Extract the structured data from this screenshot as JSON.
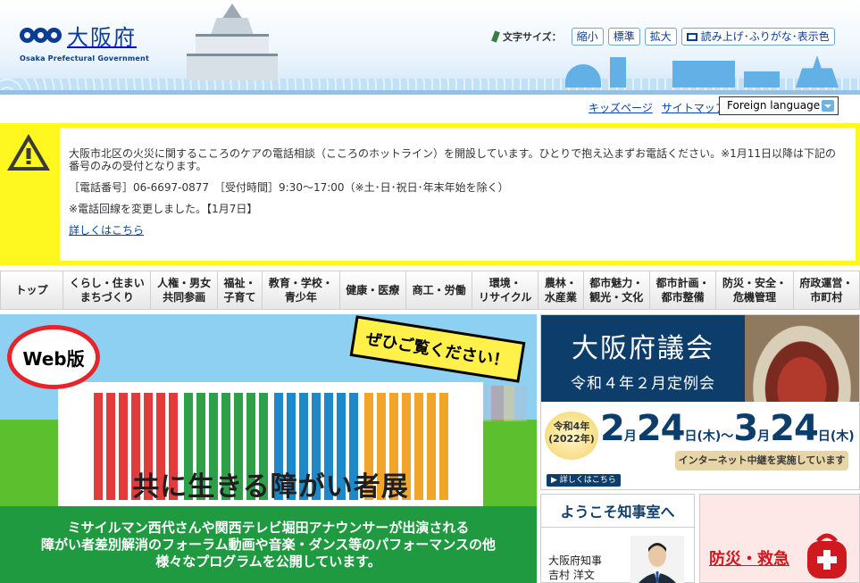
{
  "header": {
    "logo_text": "大阪府",
    "logo_sub": "Osaka Prefectural Government",
    "font_size_label": "文字サイズ：",
    "font_size_small": "縮小",
    "font_size_standard": "標準",
    "font_size_large": "拡大",
    "read_aloud": "読み上げ･ふりがな･表示色"
  },
  "subnav": {
    "kids": "キッズページ",
    "sitemap": "サイトマップ",
    "language": "Foreign language"
  },
  "alert": {
    "line1": "大阪市北区の火災に関するこころのケアの電話相談（こころのホットライン）を開設しています。ひとりで抱え込まずお電話ください。※1月11日以降は下記の番号のみの受付となります。",
    "line2": "［電話番号］06-6697-0877　［受付時間］9:30～17:00（※土･日･祝日･年末年始を除く）",
    "line3": "※電話回線を変更しました。【1月7日】",
    "link": "詳しくはこちら"
  },
  "global_nav": [
    {
      "label": "トップ"
    },
    {
      "label": "くらし・住まい\nまちづくり"
    },
    {
      "label": "人権・男女\n共同参画"
    },
    {
      "label": "福祉・\n子育て"
    },
    {
      "label": "教育・学校・\n青少年"
    },
    {
      "label": "健康・医療"
    },
    {
      "label": "商工・労働"
    },
    {
      "label": "環境・\nリサイクル"
    },
    {
      "label": "農林・\n水産業"
    },
    {
      "label": "都市魅力・\n観光・文化"
    },
    {
      "label": "都市計画・\n都市整備"
    },
    {
      "label": "防災・安全・\n危機管理"
    },
    {
      "label": "府政運営・\n市町村"
    }
  ],
  "banner": {
    "web_badge": "Web版",
    "zehi": "ぜひご覧ください！",
    "title": "共に生きる障がい者展",
    "bottom1": "ミサイルマン西代さんや関西テレビ堀田アナウンサーが出演される",
    "bottom2": "障がい者差別解消のフォーラム動画や音楽・ダンス等のパフォーマンスの他",
    "bottom3": "様々なプログラムを公開しています。"
  },
  "giin": {
    "title": "大阪府議会",
    "subtitle": "令和４年２月定例会",
    "year1": "令和4年",
    "year2": "(2022年)",
    "m1": "2",
    "d1": "24",
    "w1": "日(木)～",
    "m2": "3",
    "d2": "24",
    "w2": "日(木)",
    "month_unit": "月",
    "live": "インターネット中継を実施しています",
    "more": "▶ 詳しくはこちら"
  },
  "chiji": {
    "heading": "ようこそ知事室へ",
    "role": "大阪府知事",
    "name": "吉村 洋文"
  },
  "bousai": {
    "label": "防災・救急"
  },
  "colors": {
    "alert_yellow": "#fff71f",
    "brand_blue": "#0a3d91",
    "giin_navy": "#0d3d6b",
    "banner_green": "#1f9a40"
  }
}
